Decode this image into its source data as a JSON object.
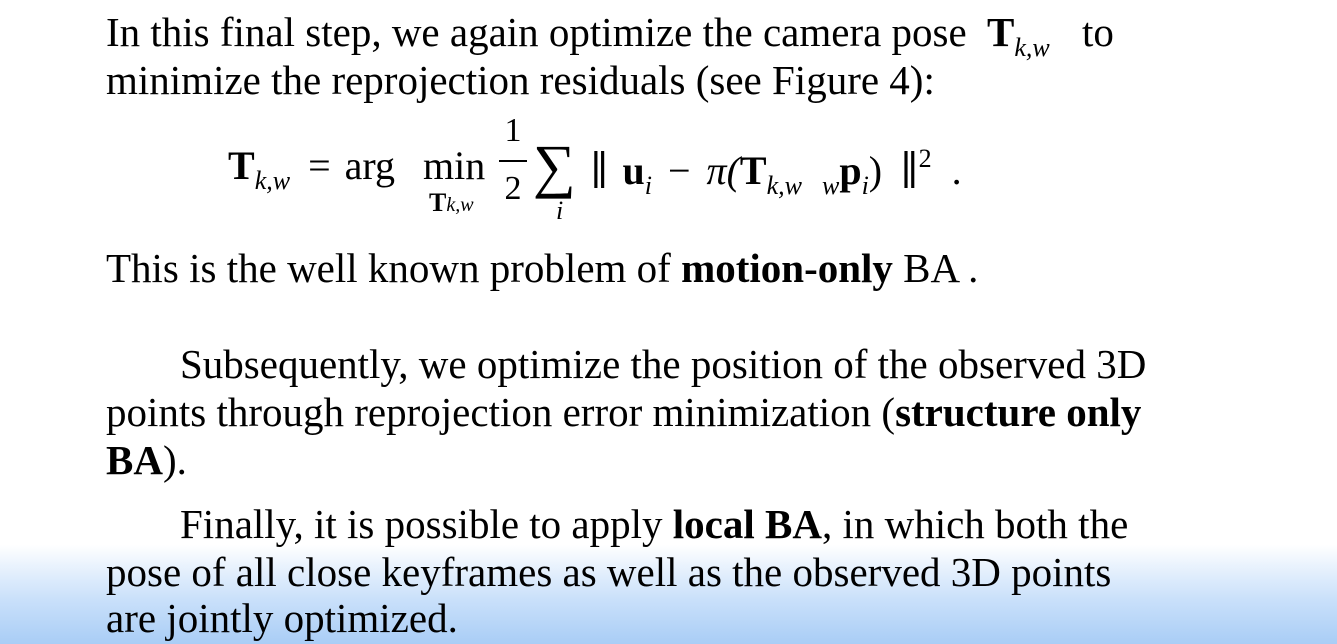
{
  "paragraph1": {
    "line1": "In this final step, we again optimize the camera pose",
    "line1_symbol": "T",
    "line1_subscript": "k,w",
    "line1_end": "to",
    "line2": "minimize the reprojection residuals (see Figure 4):"
  },
  "equation": {
    "lhs_symbol": "T",
    "lhs_subscript": "k,w",
    "equals": "=",
    "argmin": "arg",
    "min": "min",
    "min_under_symbol": "T",
    "min_under_subscript": "k,w",
    "frac_num": "1",
    "frac_den": "2",
    "sum": "∑",
    "sum_index": "i",
    "norm_open": "∥",
    "u": "u",
    "u_sub": "i",
    "minus": "−",
    "pi": "π(",
    "T": "T",
    "T_sub": "k,w",
    "w_pre": "w",
    "p": "p",
    "p_sub": "i",
    "close": ")",
    "norm_close": "∥",
    "power": "2",
    "period": "."
  },
  "paragraph2": {
    "before": "This is the well known problem of ",
    "bold": "motion-only",
    "after": " BA ."
  },
  "paragraph3": {
    "line1": "Subsequently, we optimize the position of the observed 3D",
    "line2_before": "points through reprojection error minimization (",
    "line2_bold": "structure only",
    "line3_bold": "BA",
    "line3_after": ")."
  },
  "paragraph4": {
    "line1_before": "Finally, it is possible to apply ",
    "line1_bold": "local BA",
    "line1_after": ", in which both the",
    "line2": "pose of all close keyframes as well as the observed 3D points",
    "line3": "are jointly optimized."
  },
  "colors": {
    "text": "#000000",
    "gradient_bottom": "#a9cdf6"
  }
}
